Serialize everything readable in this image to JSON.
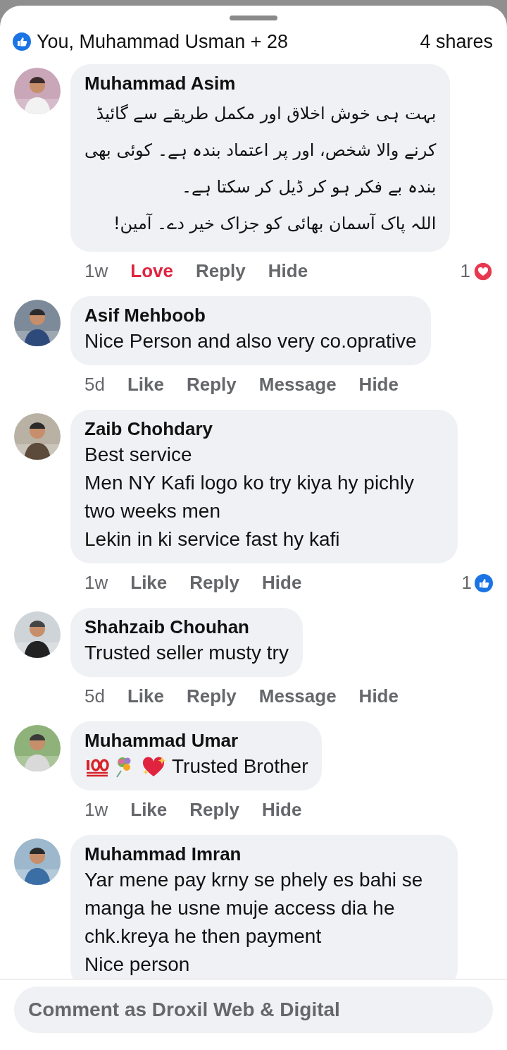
{
  "summary": {
    "reactors": "You, Muhammad Usman + 28",
    "shares": "4 shares"
  },
  "comments": [
    {
      "author": "Muhammad Asim",
      "kind": "text",
      "rtl": true,
      "lines": [
        "بہت ہی خوش اخلاق اور مکمل طریقے سے گائیڈ",
        "کرنے والا شخص، اور پر اعتماد بندہ ہے۔ کوئی بھی",
        "بندہ بے فکر ہو کر ڈیل کر سکتا ہے۔",
        "اللہ پاک آسمان بھائی کو جزاک خیر دے۔ آمین!"
      ],
      "time": "1w",
      "reacted": true,
      "actions": [
        "Love",
        "Reply",
        "Hide"
      ],
      "reactions": {
        "count": "1",
        "kind": "love"
      }
    },
    {
      "author": "Asif Mehboob",
      "kind": "text",
      "rtl": false,
      "lines": [
        "Nice Person and also very co.oprative"
      ],
      "time": "5d",
      "reacted": false,
      "actions": [
        "Like",
        "Reply",
        "Message",
        "Hide"
      ]
    },
    {
      "author": "Zaib Chohdary",
      "kind": "text",
      "rtl": false,
      "lines": [
        "Best service",
        "Men NY Kafi logo ko try kiya hy pichly two weeks men",
        "Lekin in ki service fast hy kafi"
      ],
      "time": "1w",
      "reacted": false,
      "actions": [
        "Like",
        "Reply",
        "Hide"
      ],
      "reactions": {
        "count": "1",
        "kind": "like"
      }
    },
    {
      "author": "Shahzaib Chouhan",
      "kind": "text",
      "rtl": false,
      "lines": [
        "Trusted seller musty try"
      ],
      "time": "5d",
      "reacted": false,
      "actions": [
        "Like",
        "Reply",
        "Message",
        "Hide"
      ]
    },
    {
      "author": "Muhammad Umar",
      "kind": "emoji_text",
      "rtl": false,
      "lines": [
        "Trusted Brother"
      ],
      "time": "1w",
      "reacted": false,
      "actions": [
        "Like",
        "Reply",
        "Hide"
      ]
    },
    {
      "author": "Muhammad Imran",
      "kind": "text",
      "rtl": false,
      "lines": [
        "Yar mene pay krny se phely es bahi se manga he usne muje access dia he chk.kreya he then payment",
        "Nice person"
      ]
    }
  ],
  "composer": {
    "placeholder": "Comment as Droxil Web & Digital"
  }
}
